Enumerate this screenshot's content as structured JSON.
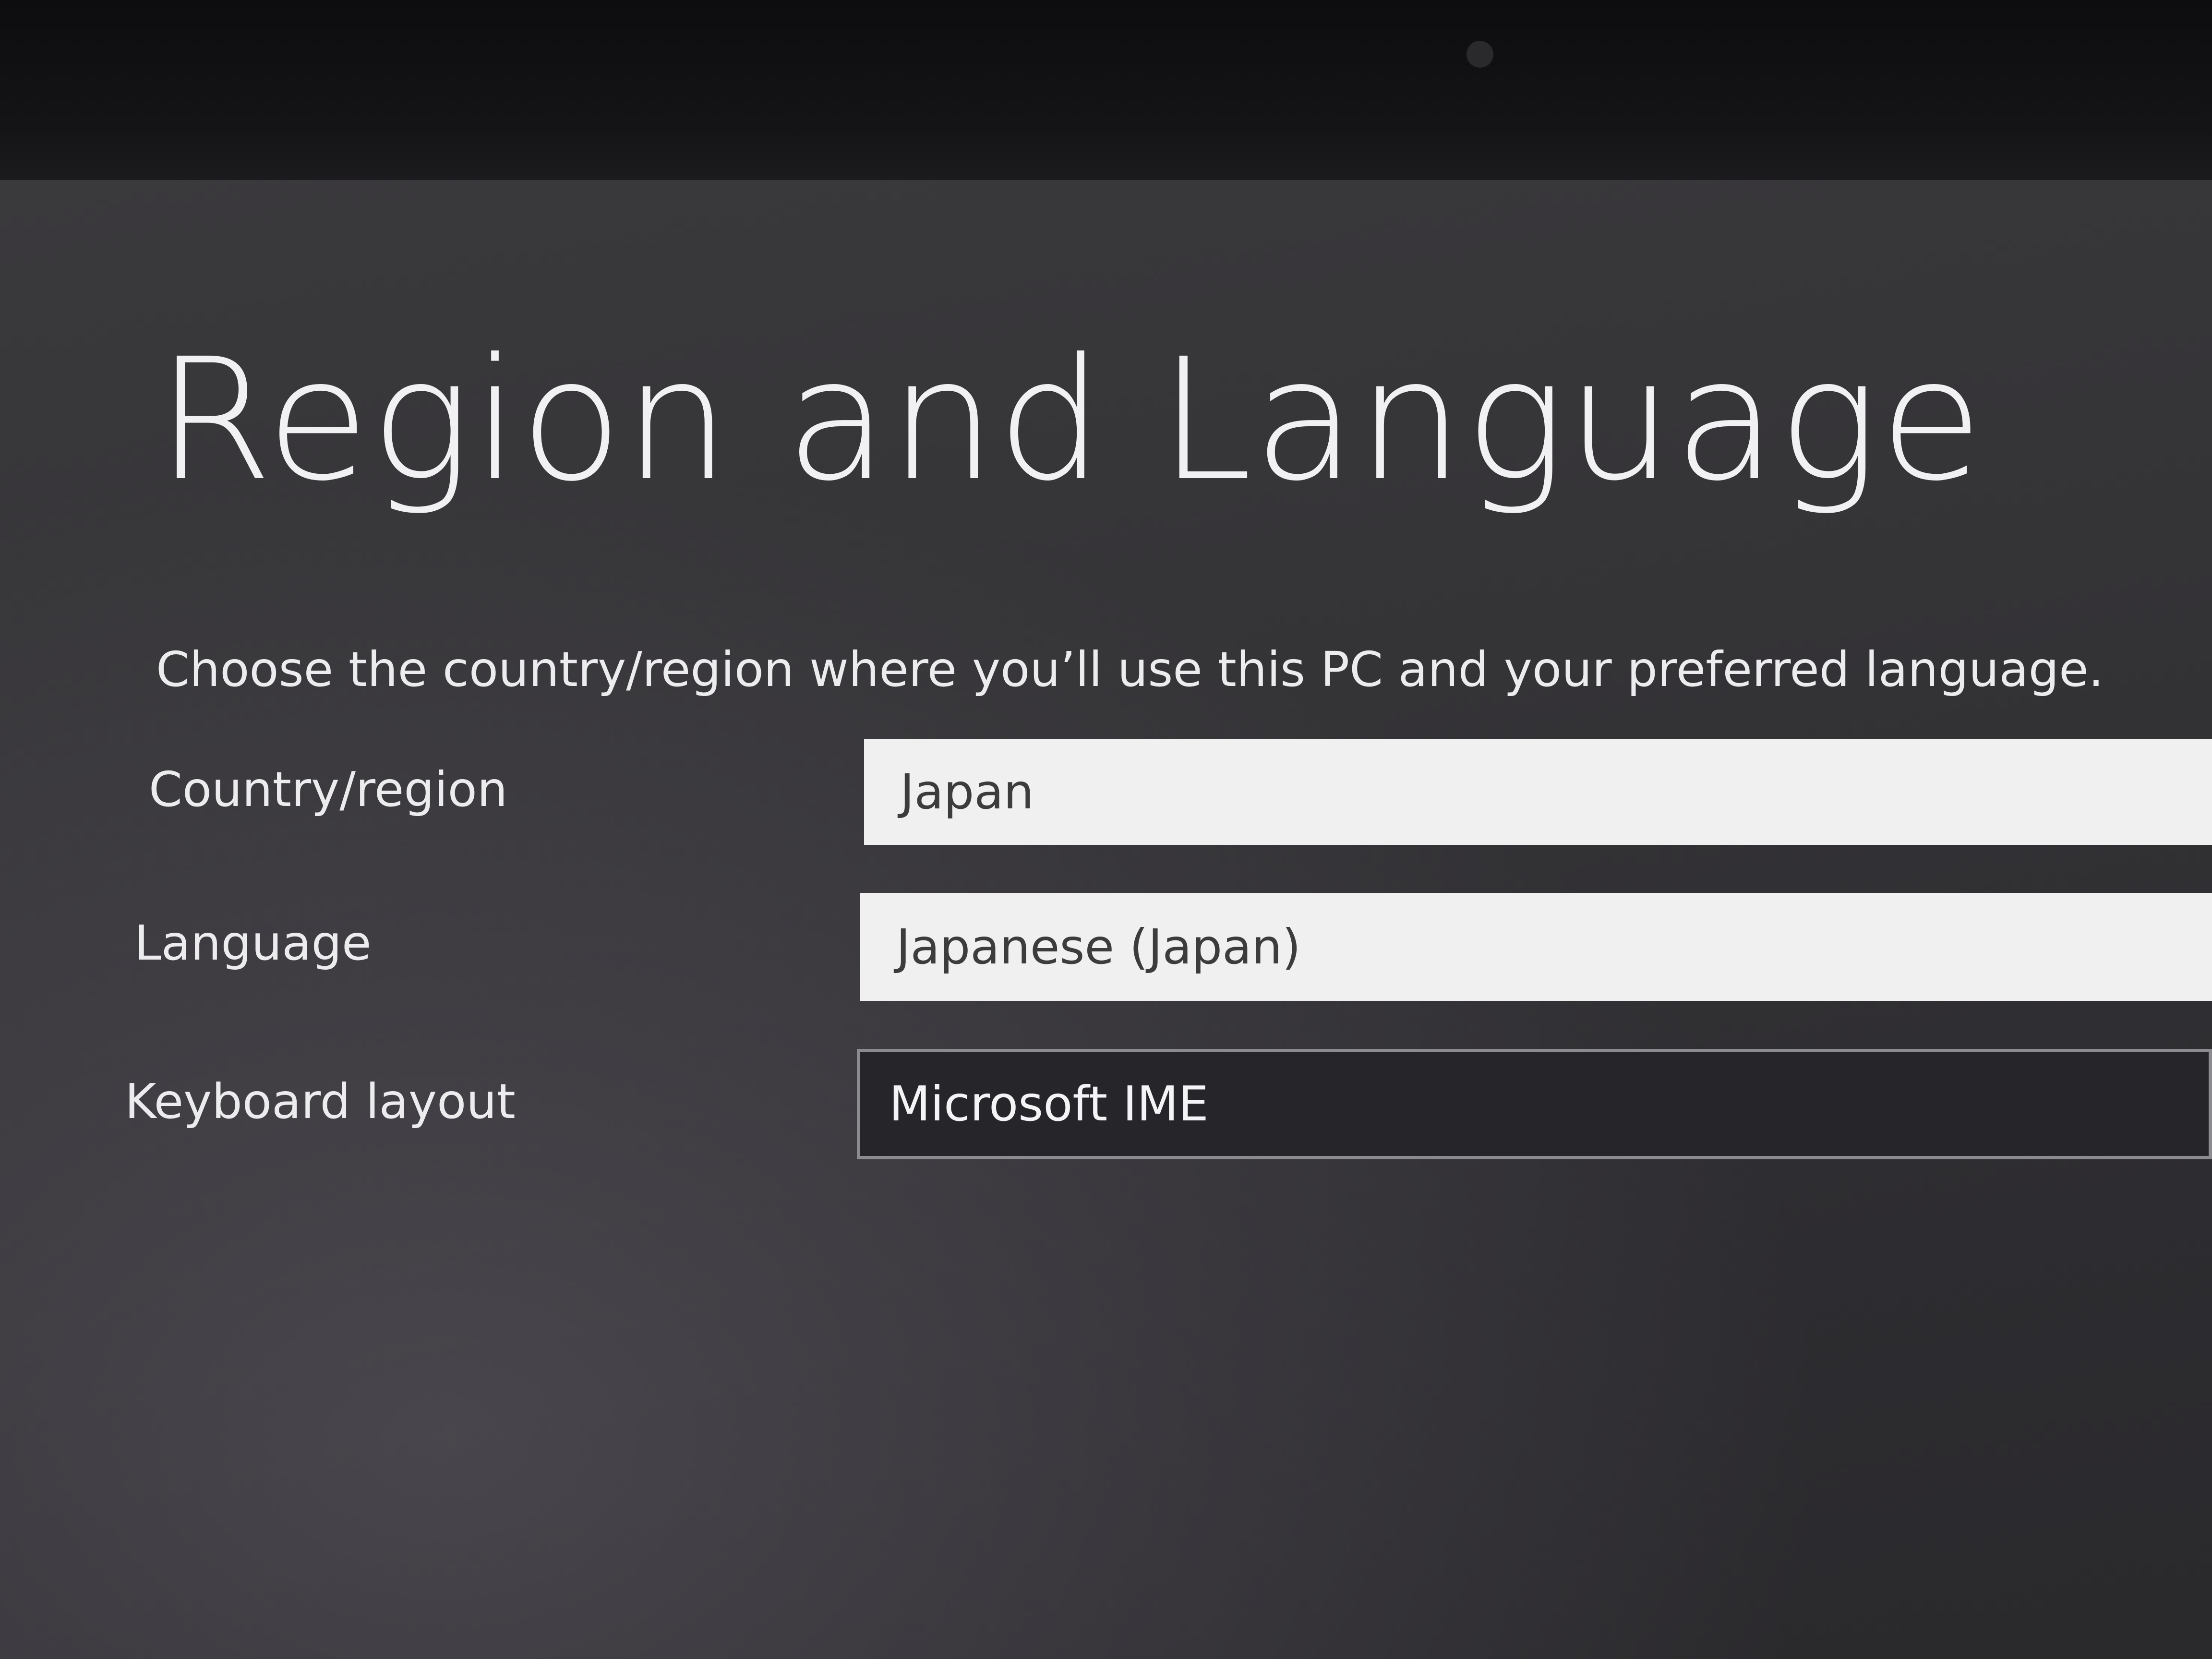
{
  "page": {
    "title": "Region and Language",
    "subtitle": "Choose the country/region where you’ll use this PC and your preferred language."
  },
  "form": {
    "country": {
      "label": "Country/region",
      "value": "Japan"
    },
    "language": {
      "label": "Language",
      "value": "Japanese (Japan)"
    },
    "keyboard": {
      "label": "Keyboard layout",
      "value": "Microsoft IME"
    }
  },
  "colors": {
    "background": "#333236",
    "text": "#ececee",
    "select_fill": "#f0f0f0",
    "input_border": "#8c8c90"
  }
}
